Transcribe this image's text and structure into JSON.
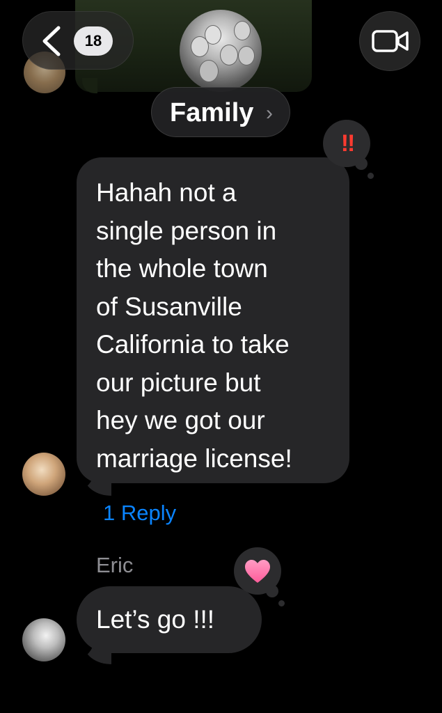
{
  "header": {
    "unread_count": "18",
    "conversation_title": "Family",
    "title_chevron": "›",
    "back_icon": "chevron-left-icon",
    "video_icon": "video-camera-icon"
  },
  "messages": [
    {
      "text": "Hahah not a\nsingle person in\nthe whole town\nof Susanville\nCalifornia to take\nour picture but\nhey we got our\nmarriage license!",
      "tapback": "‼",
      "tapback_icon": "double-exclamation-icon",
      "reply_link": "1 Reply"
    },
    {
      "sender": "Eric",
      "text": "Let’s go !!!",
      "tapback_icon": "heart-icon"
    }
  ],
  "colors": {
    "background": "#000000",
    "bubble": "#262628",
    "link": "#0a84ff",
    "secondary_text": "#8e8e93",
    "emphasis_red": "#ff3b30",
    "heart_pink": "#ff6fa8"
  }
}
